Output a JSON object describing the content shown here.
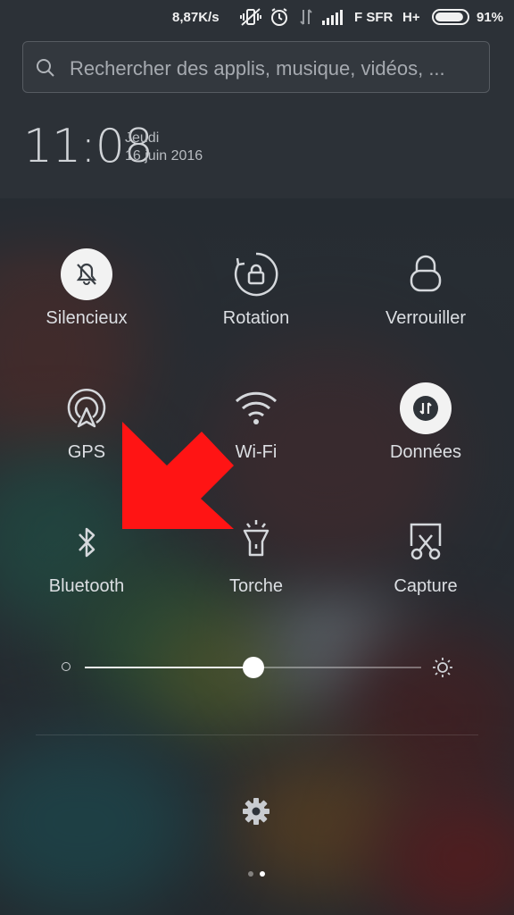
{
  "status_bar": {
    "speed": "8,87K/s",
    "carrier": "F SFR",
    "network": "H+",
    "battery_pct": "91%",
    "battery_level": 0.91
  },
  "search": {
    "placeholder": "Rechercher des applis, musique, vidéos, ..."
  },
  "header": {
    "time": "11:08",
    "day": "Jeudi",
    "date": "16 juin 2016"
  },
  "toggles": [
    {
      "label": "Silencieux",
      "icon": "bell-off-icon",
      "active": true
    },
    {
      "label": "Rotation",
      "icon": "rotation-lock-icon",
      "active": false
    },
    {
      "label": "Verrouiller",
      "icon": "lock-icon",
      "active": false
    },
    {
      "label": "GPS",
      "icon": "gps-icon",
      "active": false
    },
    {
      "label": "Wi-Fi",
      "icon": "wifi-icon",
      "active": false
    },
    {
      "label": "Données",
      "icon": "data-icon",
      "active": true
    },
    {
      "label": "Bluetooth",
      "icon": "bluetooth-icon",
      "active": false
    },
    {
      "label": "Torche",
      "icon": "flashlight-icon",
      "active": false
    },
    {
      "label": "Capture",
      "icon": "screenshot-icon",
      "active": false
    }
  ],
  "brightness": {
    "level": 0.5
  },
  "pagination": {
    "pages": 2,
    "current": 2
  },
  "colors": {
    "accent_arrow": "#ff1414",
    "active_circle": "#f2f2f2"
  }
}
